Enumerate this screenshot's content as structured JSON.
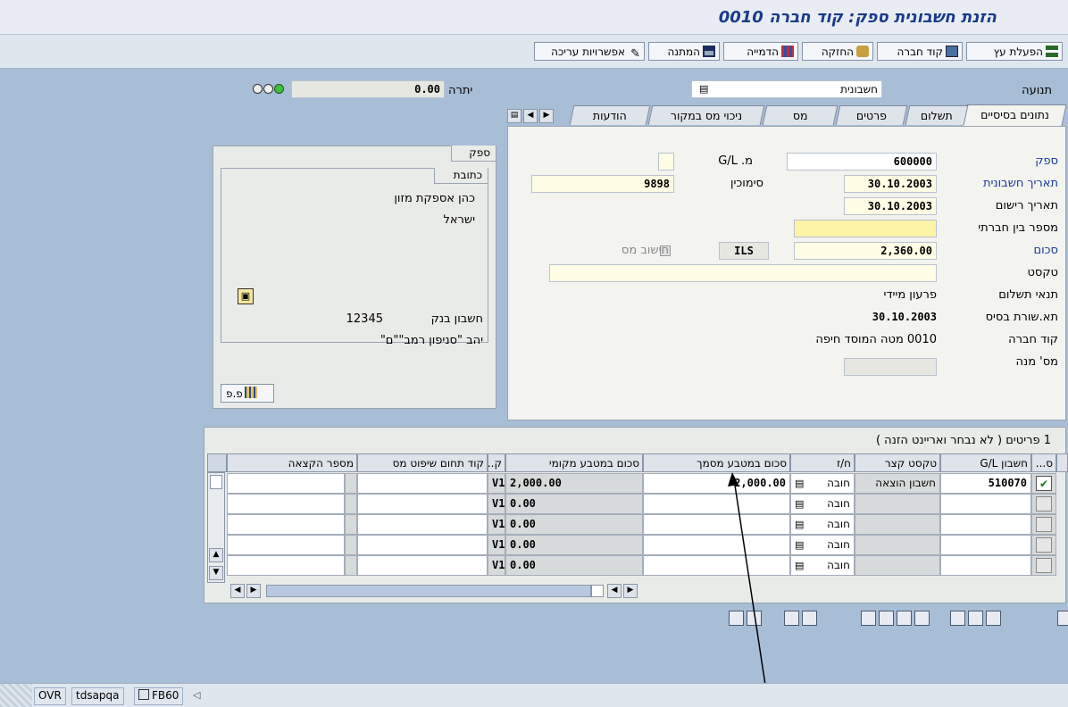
{
  "title": "הזנת חשבונית ספק: קוד חברה 0010",
  "toolbar": {
    "tree_on": "הפעלת עץ",
    "company_code": "קוד חברה",
    "hold": "החזקה",
    "simulate": "הדמייה",
    "park": "המתנה",
    "editing_options": "אפשרויות עריכה"
  },
  "header": {
    "transaction_label": "תנועה",
    "transaction_value": "חשבונית",
    "balance_label": "יתרה",
    "balance_value": "0.00"
  },
  "tabs": [
    "נתונים בסיסיים",
    "תשלום",
    "פרטים",
    "מס",
    "ניכוי מס במקור",
    "הודעות"
  ],
  "form": {
    "vendor_label": "ספק",
    "vendor_value": "600000",
    "invoice_date_label": "תאריך חשבונית",
    "invoice_date_value": "30.10.2003",
    "posting_date_label": "תאריך רישום",
    "posting_date_value": "30.10.2003",
    "intercompany_label": "מספר בין חברתי",
    "amount_label": "סכום",
    "amount_value": "2,360.00",
    "currency_value": "ILS",
    "calc_tax_label": "חישוב מס",
    "text_label": "טקסט",
    "payment_terms_label": "תנאי תשלום",
    "payment_terms_value": "פרעון מיידי",
    "baseline_label": "תא.שורת בסיס",
    "baseline_value": "30.10.2003",
    "company_code_label": "קוד חברה",
    "company_code_value": "0010 מטה המוסד חיפה",
    "share_label": "מס' מנה",
    "gl_label": "G/L .מ",
    "reference_label": "סימוכין",
    "reference_value": "9898"
  },
  "vendor_panel": {
    "title": "ספק",
    "address_tab": "כתובת",
    "name": "כהן אספקת מזון",
    "country": "ישראל",
    "bank_label": "חשבון בנק",
    "bank_value": "12345",
    "bank_name": "יהב \"סניפון רמב\"\"ם\"",
    "oi_label": "פ.פ"
  },
  "items": {
    "caption": "1 פריטים ( לא נבחר ואריינט הזנה )",
    "columns": [
      "ס...",
      "חשבון G/L",
      "טקסט קצר",
      "ח/ז",
      "סכום במטבע מסמך",
      "סכום במטבע מקומי",
      "ק...",
      "קוד תחום שיפוט מס",
      "מספר הקצאה"
    ],
    "rows": [
      {
        "account": "510070",
        "short_text": "חשבון הוצאה",
        "dc": "חובה",
        "doc_amount": "2,000.00",
        "tax": "V1",
        "local_amount": "2,000.00",
        "checked": true
      },
      {
        "account": "",
        "short_text": "",
        "dc": "חובה",
        "doc_amount": "",
        "tax": "V1",
        "local_amount": "0.00",
        "checked": false
      },
      {
        "account": "",
        "short_text": "",
        "dc": "חובה",
        "doc_amount": "",
        "tax": "V1",
        "local_amount": "0.00",
        "checked": false
      },
      {
        "account": "",
        "short_text": "",
        "dc": "חובה",
        "doc_amount": "",
        "tax": "V1",
        "local_amount": "0.00",
        "checked": false
      },
      {
        "account": "",
        "short_text": "",
        "dc": "חובה",
        "doc_amount": "",
        "tax": "V1",
        "local_amount": "0.00",
        "checked": false
      }
    ]
  },
  "status": {
    "mode": "OVR",
    "server": "tdsapqa",
    "tcode": "FB60"
  },
  "colors": {
    "background": "#a8bdd6",
    "title": "#1a3a8a",
    "link_label": "#1a3a9a",
    "required_field": "#fdf4a8"
  }
}
